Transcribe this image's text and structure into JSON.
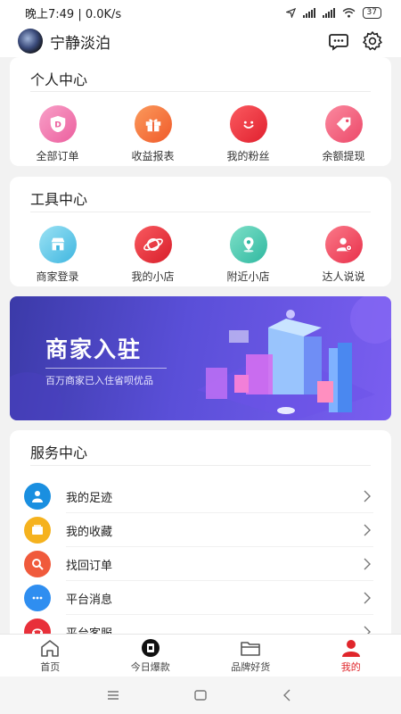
{
  "status_bar": {
    "time": "晚上7:49 | 0.0K/s",
    "battery": "37"
  },
  "header": {
    "username": "宁静淡泊"
  },
  "personal": {
    "title": "个人中心",
    "items": [
      {
        "label": "全部订单",
        "icon": "order-shield-icon",
        "color": "#f07fb0"
      },
      {
        "label": "收益报表",
        "icon": "gift-icon",
        "color": "#f5743f"
      },
      {
        "label": "我的粉丝",
        "icon": "smile-icon",
        "color": "#ef3340"
      },
      {
        "label": "余额提现",
        "icon": "tag-icon",
        "color": "#f0607a"
      }
    ]
  },
  "tools": {
    "title": "工具中心",
    "items": [
      {
        "label": "商家登录",
        "icon": "store-icon",
        "color": "#5cc6e8"
      },
      {
        "label": "我的小店",
        "icon": "planet-icon",
        "color": "#e8303a"
      },
      {
        "label": "附近小店",
        "icon": "location-pin-icon",
        "color": "#3fc9b0"
      },
      {
        "label": "达人说说",
        "icon": "user-chat-icon",
        "color": "#f04760"
      }
    ]
  },
  "banner": {
    "title": "商家入驻",
    "subtitle": "百万商家已入住省呗优品"
  },
  "service": {
    "title": "服务中心",
    "items": [
      {
        "label": "我的足迹",
        "icon": "footprint-user-icon",
        "color": "#1a8fe0"
      },
      {
        "label": "我的收藏",
        "icon": "folder-star-icon",
        "color": "#f5b21e"
      },
      {
        "label": "找回订单",
        "icon": "search-order-icon",
        "color": "#f05a3c"
      },
      {
        "label": "平台消息",
        "icon": "message-icon",
        "color": "#2f8ef0"
      },
      {
        "label": "平台客服",
        "icon": "customer-service-icon",
        "color": "#e8303a"
      }
    ]
  },
  "tabbar": {
    "items": [
      {
        "label": "首页",
        "icon": "home-icon",
        "active": false
      },
      {
        "label": "今日爆款",
        "icon": "hot-deal-icon",
        "active": false
      },
      {
        "label": "品牌好货",
        "icon": "folder-icon",
        "active": false
      },
      {
        "label": "我的",
        "icon": "profile-icon",
        "active": true
      }
    ],
    "accent": "#e0262b"
  }
}
